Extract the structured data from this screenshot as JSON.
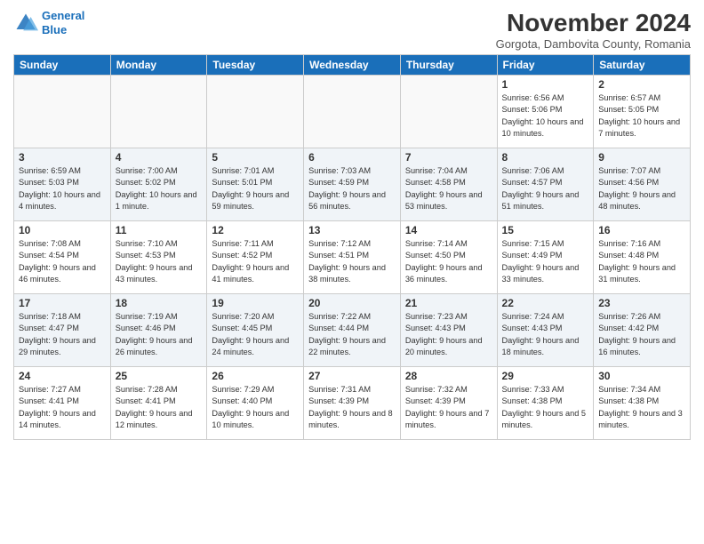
{
  "logo": {
    "line1": "General",
    "line2": "Blue"
  },
  "title": "November 2024",
  "subtitle": "Gorgota, Dambovita County, Romania",
  "days_of_week": [
    "Sunday",
    "Monday",
    "Tuesday",
    "Wednesday",
    "Thursday",
    "Friday",
    "Saturday"
  ],
  "weeks": [
    {
      "days": [
        {
          "num": "",
          "info": ""
        },
        {
          "num": "",
          "info": ""
        },
        {
          "num": "",
          "info": ""
        },
        {
          "num": "",
          "info": ""
        },
        {
          "num": "",
          "info": ""
        },
        {
          "num": "1",
          "info": "Sunrise: 6:56 AM\nSunset: 5:06 PM\nDaylight: 10 hours and 10 minutes."
        },
        {
          "num": "2",
          "info": "Sunrise: 6:57 AM\nSunset: 5:05 PM\nDaylight: 10 hours and 7 minutes."
        }
      ]
    },
    {
      "days": [
        {
          "num": "3",
          "info": "Sunrise: 6:59 AM\nSunset: 5:03 PM\nDaylight: 10 hours and 4 minutes."
        },
        {
          "num": "4",
          "info": "Sunrise: 7:00 AM\nSunset: 5:02 PM\nDaylight: 10 hours and 1 minute."
        },
        {
          "num": "5",
          "info": "Sunrise: 7:01 AM\nSunset: 5:01 PM\nDaylight: 9 hours and 59 minutes."
        },
        {
          "num": "6",
          "info": "Sunrise: 7:03 AM\nSunset: 4:59 PM\nDaylight: 9 hours and 56 minutes."
        },
        {
          "num": "7",
          "info": "Sunrise: 7:04 AM\nSunset: 4:58 PM\nDaylight: 9 hours and 53 minutes."
        },
        {
          "num": "8",
          "info": "Sunrise: 7:06 AM\nSunset: 4:57 PM\nDaylight: 9 hours and 51 minutes."
        },
        {
          "num": "9",
          "info": "Sunrise: 7:07 AM\nSunset: 4:56 PM\nDaylight: 9 hours and 48 minutes."
        }
      ]
    },
    {
      "days": [
        {
          "num": "10",
          "info": "Sunrise: 7:08 AM\nSunset: 4:54 PM\nDaylight: 9 hours and 46 minutes."
        },
        {
          "num": "11",
          "info": "Sunrise: 7:10 AM\nSunset: 4:53 PM\nDaylight: 9 hours and 43 minutes."
        },
        {
          "num": "12",
          "info": "Sunrise: 7:11 AM\nSunset: 4:52 PM\nDaylight: 9 hours and 41 minutes."
        },
        {
          "num": "13",
          "info": "Sunrise: 7:12 AM\nSunset: 4:51 PM\nDaylight: 9 hours and 38 minutes."
        },
        {
          "num": "14",
          "info": "Sunrise: 7:14 AM\nSunset: 4:50 PM\nDaylight: 9 hours and 36 minutes."
        },
        {
          "num": "15",
          "info": "Sunrise: 7:15 AM\nSunset: 4:49 PM\nDaylight: 9 hours and 33 minutes."
        },
        {
          "num": "16",
          "info": "Sunrise: 7:16 AM\nSunset: 4:48 PM\nDaylight: 9 hours and 31 minutes."
        }
      ]
    },
    {
      "days": [
        {
          "num": "17",
          "info": "Sunrise: 7:18 AM\nSunset: 4:47 PM\nDaylight: 9 hours and 29 minutes."
        },
        {
          "num": "18",
          "info": "Sunrise: 7:19 AM\nSunset: 4:46 PM\nDaylight: 9 hours and 26 minutes."
        },
        {
          "num": "19",
          "info": "Sunrise: 7:20 AM\nSunset: 4:45 PM\nDaylight: 9 hours and 24 minutes."
        },
        {
          "num": "20",
          "info": "Sunrise: 7:22 AM\nSunset: 4:44 PM\nDaylight: 9 hours and 22 minutes."
        },
        {
          "num": "21",
          "info": "Sunrise: 7:23 AM\nSunset: 4:43 PM\nDaylight: 9 hours and 20 minutes."
        },
        {
          "num": "22",
          "info": "Sunrise: 7:24 AM\nSunset: 4:43 PM\nDaylight: 9 hours and 18 minutes."
        },
        {
          "num": "23",
          "info": "Sunrise: 7:26 AM\nSunset: 4:42 PM\nDaylight: 9 hours and 16 minutes."
        }
      ]
    },
    {
      "days": [
        {
          "num": "24",
          "info": "Sunrise: 7:27 AM\nSunset: 4:41 PM\nDaylight: 9 hours and 14 minutes."
        },
        {
          "num": "25",
          "info": "Sunrise: 7:28 AM\nSunset: 4:41 PM\nDaylight: 9 hours and 12 minutes."
        },
        {
          "num": "26",
          "info": "Sunrise: 7:29 AM\nSunset: 4:40 PM\nDaylight: 9 hours and 10 minutes."
        },
        {
          "num": "27",
          "info": "Sunrise: 7:31 AM\nSunset: 4:39 PM\nDaylight: 9 hours and 8 minutes."
        },
        {
          "num": "28",
          "info": "Sunrise: 7:32 AM\nSunset: 4:39 PM\nDaylight: 9 hours and 7 minutes."
        },
        {
          "num": "29",
          "info": "Sunrise: 7:33 AM\nSunset: 4:38 PM\nDaylight: 9 hours and 5 minutes."
        },
        {
          "num": "30",
          "info": "Sunrise: 7:34 AM\nSunset: 4:38 PM\nDaylight: 9 hours and 3 minutes."
        }
      ]
    }
  ]
}
